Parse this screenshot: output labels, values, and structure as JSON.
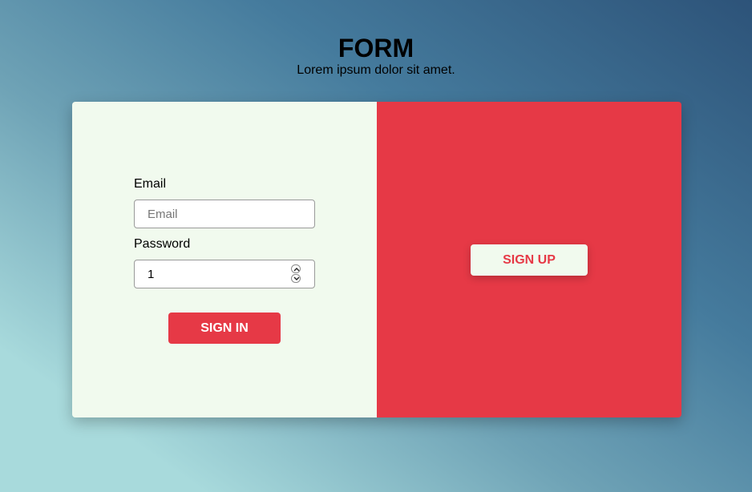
{
  "header": {
    "title": "FORM",
    "subtitle": "Lorem ipsum dolor sit amet."
  },
  "signin": {
    "email_label": "Email",
    "email_placeholder": "Email",
    "email_value": "",
    "password_label": "Password",
    "password_value": "1",
    "button_label": "SIGN IN"
  },
  "signup": {
    "button_label": "SIGN UP"
  },
  "colors": {
    "accent_red": "#e63946",
    "panel_light": "#f1faee"
  },
  "icons": {
    "spinner_up": "chevron-up-icon",
    "spinner_down": "chevron-down-icon"
  }
}
